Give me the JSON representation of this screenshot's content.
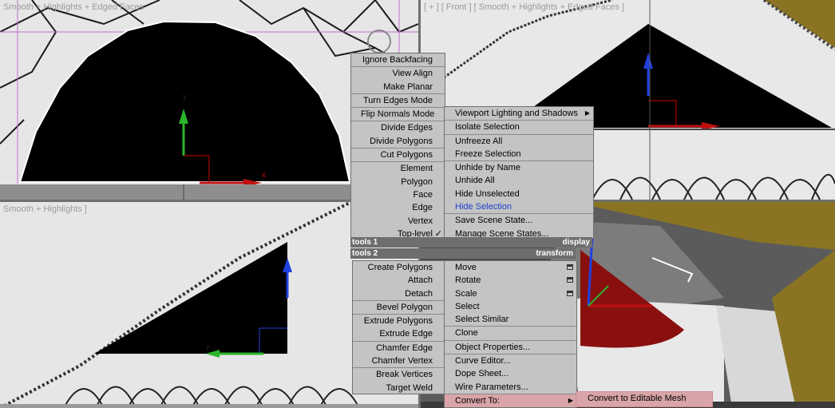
{
  "viewports": {
    "top_left_label": "Smooth + Highlights + Edged Faces",
    "top_right_label": "[ + ] [ Front ] [ Smooth + Highlights + Edged Faces ]",
    "bottom_left_label": "Smooth + Highlights ]",
    "axis_x": "x",
    "axis_y": "y",
    "axis_z": "z"
  },
  "colors": {
    "menu_bg": "#c4c4c4",
    "header_bg": "#6e6e6e",
    "highlight": "#d9a5a8",
    "link_blue": "#1f3fd0"
  },
  "quad_menu": {
    "tools1_items": [
      {
        "label": "Ignore Backfacing"
      },
      {
        "label": "View Align"
      },
      {
        "label": "Make Planar"
      },
      {
        "label": "Turn Edges Mode"
      },
      {
        "label": "Flip Normals Mode"
      },
      {
        "label": "Divide Edges"
      },
      {
        "label": "Divide Polygons"
      },
      {
        "label": "Cut Polygons"
      },
      {
        "label": "Element"
      },
      {
        "label": "Polygon"
      },
      {
        "label": "Face"
      },
      {
        "label": "Edge"
      },
      {
        "label": "Vertex"
      },
      {
        "label": "Top-level",
        "checked": true
      }
    ],
    "display_items": [
      {
        "label": "Viewport Lighting and Shadows"
      },
      {
        "label": "Isolate Selection"
      },
      {
        "label": "Unfreeze All"
      },
      {
        "label": "Freeze Selection"
      },
      {
        "label": "Unhide by Name"
      },
      {
        "label": "Unhide All"
      },
      {
        "label": "Hide Unselected"
      },
      {
        "label": "Hide Selection"
      },
      {
        "label": "Save Scene State..."
      },
      {
        "label": "Manage Scene States..."
      }
    ],
    "header_tools1": "tools 1",
    "header_display": "display",
    "header_tools2": "tools 2",
    "header_transform": "transform",
    "tools2_items": [
      {
        "label": "Create Polygons"
      },
      {
        "label": "Attach"
      },
      {
        "label": "Detach"
      },
      {
        "label": "Bevel Polygon"
      },
      {
        "label": "Extrude Polygons"
      },
      {
        "label": "Extrude Edge"
      },
      {
        "label": "Chamfer Edge"
      },
      {
        "label": "Chamfer Vertex"
      },
      {
        "label": "Break Vertices"
      },
      {
        "label": "Target Weld"
      }
    ],
    "transform_items": [
      {
        "label": "Move"
      },
      {
        "label": "Rotate"
      },
      {
        "label": "Scale"
      },
      {
        "label": "Select"
      },
      {
        "label": "Select Similar"
      },
      {
        "label": "Clone"
      },
      {
        "label": "Object Properties..."
      },
      {
        "label": "Curve Editor..."
      },
      {
        "label": "Dope Sheet..."
      },
      {
        "label": "Wire Parameters..."
      },
      {
        "label": "Convert To:"
      }
    ],
    "submenu_convert": "Convert to Editable Mesh",
    "submenu_arrow": "▶",
    "check_mark": "✓"
  }
}
